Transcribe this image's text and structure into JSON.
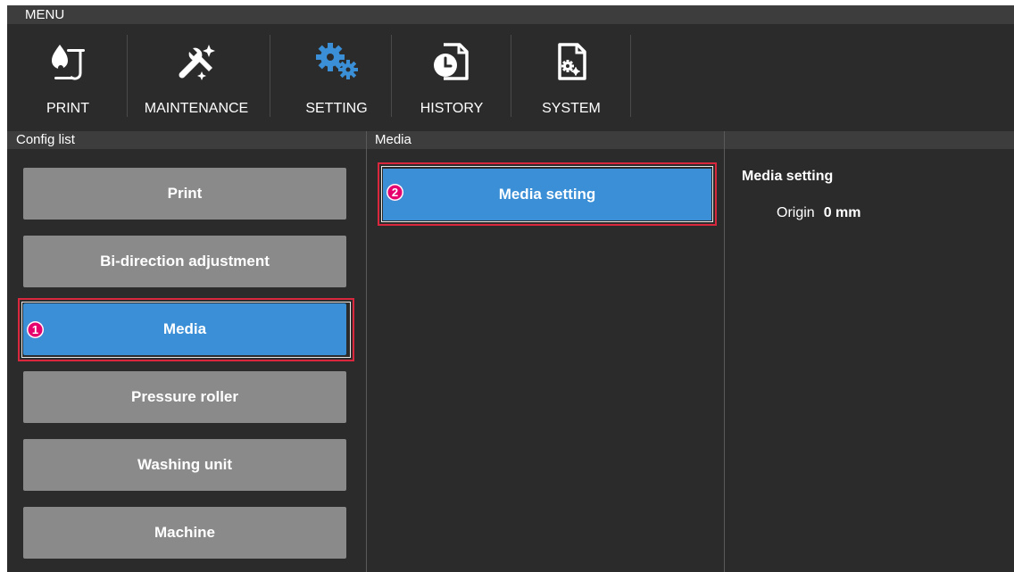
{
  "menubar": {
    "title": "MENU"
  },
  "toolbar": {
    "items": [
      {
        "label": "PRINT",
        "icon": "print-icon"
      },
      {
        "label": "MAINTENANCE",
        "icon": "maintenance-icon"
      },
      {
        "label": "SETTING",
        "icon": "setting-gears-icon",
        "active": true
      },
      {
        "label": "HISTORY",
        "icon": "history-icon"
      },
      {
        "label": "SYSTEM",
        "icon": "system-icon"
      }
    ]
  },
  "columns": {
    "config_list": "Config list",
    "media": "Media",
    "detail": ""
  },
  "config_list": {
    "items": [
      {
        "label": "Print"
      },
      {
        "label": "Bi-direction adjustment"
      },
      {
        "label": "Media",
        "selected": true,
        "callout": "1"
      },
      {
        "label": "Pressure roller"
      },
      {
        "label": "Washing unit"
      },
      {
        "label": "Machine"
      }
    ]
  },
  "media": {
    "items": [
      {
        "label": "Media setting",
        "callout": "2"
      }
    ]
  },
  "detail": {
    "title": "Media setting",
    "rows": [
      {
        "label": "Origin",
        "value": "0 mm"
      }
    ]
  },
  "colors": {
    "accent": "#3a8fd6",
    "button_gray": "#8a8a8a",
    "highlight_red": "#d9283e",
    "callout_magenta": "#e6006e",
    "background": "#2b2b2b"
  }
}
